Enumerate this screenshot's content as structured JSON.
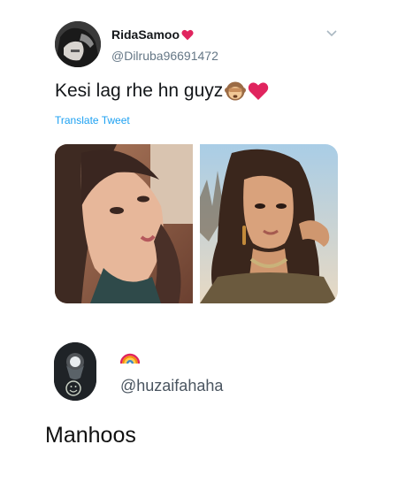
{
  "tweet": {
    "display_name": "RidaSamoo",
    "handle": "@Dilruba96691472",
    "text": "Kesi lag rhe hn guyz",
    "translate_label": "Translate Tweet",
    "icons": [
      "heart-emoji",
      "monkey-emoji",
      "chevron-down-icon"
    ],
    "media_count": 2
  },
  "reply": {
    "handle": "@huzaifahaha",
    "text": "Manhoos",
    "icons": [
      "rainbow-emoji"
    ]
  },
  "colors": {
    "link": "#1da1f2",
    "secondary_text": "#657786",
    "heart": "#e0245e"
  }
}
